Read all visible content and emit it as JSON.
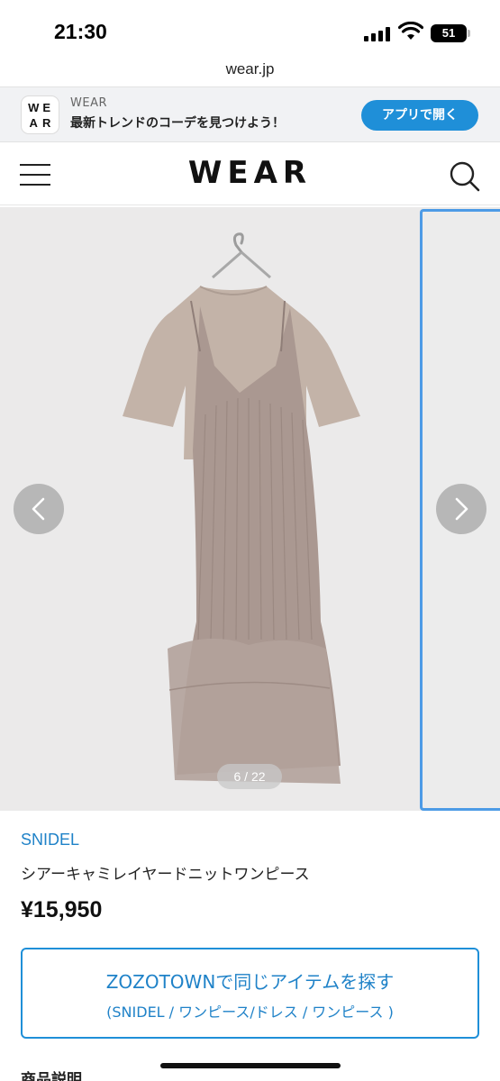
{
  "status_bar": {
    "time": "21:30",
    "battery": "51"
  },
  "browser": {
    "url": "wear.jp"
  },
  "app_banner": {
    "logo_letters": [
      "W",
      "E",
      "A",
      "R"
    ],
    "app_name": "WEAR",
    "tagline": "最新トレンドのコーデを見つけよう！",
    "open_button": "アプリで開く",
    "accent_color": "#1f8fd8"
  },
  "header": {
    "logo": "WEAR",
    "icons": [
      "hamburger-menu-icon",
      "search-icon"
    ]
  },
  "gallery": {
    "counter": "6 / 22",
    "current_index": 6,
    "total": 22,
    "icons": [
      "chevron-left-icon",
      "chevron-right-icon"
    ]
  },
  "product": {
    "brand": "SNIDEL",
    "name": "シアーキャミレイヤードニットワンピース",
    "price": "¥15,950",
    "brand_color": "#1f82c8"
  },
  "zozo_link": {
    "title": "ZOZOTOWNで同じアイテムを探す",
    "subtitle": "(SNIDEL / ワンピース/ドレス / ワンピース )"
  },
  "description": {
    "heading": "商品説明"
  }
}
